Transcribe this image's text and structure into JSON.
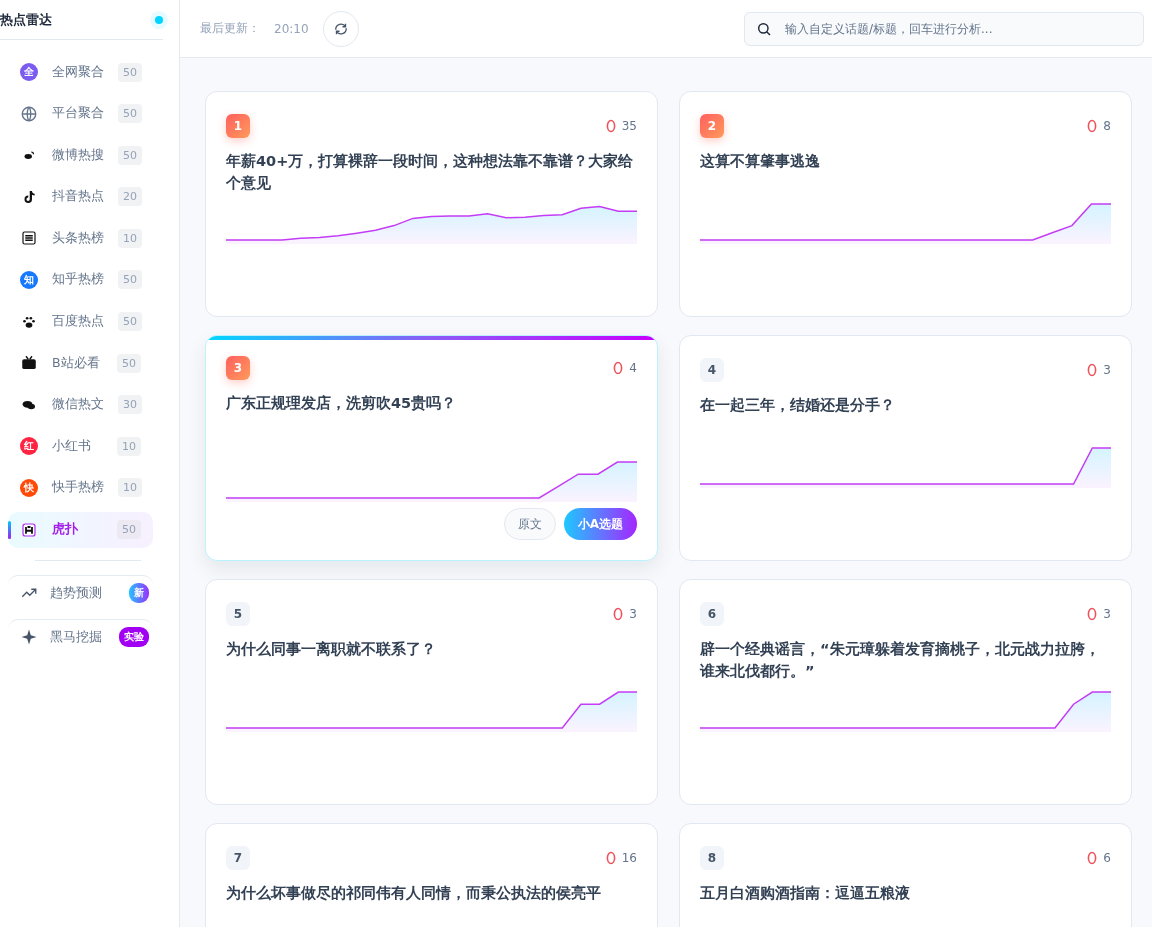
{
  "sidebar": {
    "title": "热点雷达",
    "status_on": true,
    "items": [
      {
        "kind": "letter",
        "icon_text": "全",
        "color": "#7b5cf0",
        "label": "全网聚合",
        "count": "50",
        "selected": false
      },
      {
        "kind": "globe",
        "label": "平台聚合",
        "count": "50",
        "selected": false
      },
      {
        "kind": "weibo",
        "label": "微博热搜",
        "count": "50",
        "selected": false
      },
      {
        "kind": "douyin",
        "label": "抖音热点",
        "count": "20",
        "selected": false
      },
      {
        "kind": "toutiao",
        "label": "头条热榜",
        "count": "10",
        "selected": false
      },
      {
        "kind": "letter",
        "icon_text": "知",
        "color": "#1677ff",
        "label": "知乎热榜",
        "count": "50",
        "selected": false
      },
      {
        "kind": "paw",
        "label": "百度热点",
        "count": "50",
        "selected": false
      },
      {
        "kind": "tv",
        "label": "B站必看",
        "count": "50",
        "selected": false
      },
      {
        "kind": "wechat",
        "label": "微信热文",
        "count": "30",
        "selected": false
      },
      {
        "kind": "letter",
        "icon_text": "红",
        "color": "#ff2442",
        "label": "小红书",
        "count": "10",
        "selected": false
      },
      {
        "kind": "letter",
        "icon_text": "快",
        "color": "#ff4906",
        "label": "快手热榜",
        "count": "10",
        "selected": false
      },
      {
        "kind": "hupu",
        "label": "虎扑",
        "count": "50",
        "selected": true
      }
    ],
    "tools": [
      {
        "kind": "trend",
        "label": "趋势预测",
        "badge": "新"
      },
      {
        "kind": "sparkle",
        "label": "黑马挖掘",
        "badge": "实验"
      }
    ]
  },
  "topbar": {
    "updated_label": "最后更新：",
    "updated_time": "20:10",
    "search": {
      "placeholder": "输入自定义话题/标题，回车进行分析..."
    }
  },
  "cards": [
    {
      "rank": "1",
      "top": true,
      "heat": "35",
      "title": "年薪40+万，打算裸辞一段时间，这种想法靠不靠谱？大家给个意见",
      "selected": false
    },
    {
      "rank": "2",
      "top": true,
      "heat": "8",
      "title": "这算不算肇事逃逸",
      "selected": false
    },
    {
      "rank": "3",
      "top": true,
      "heat": "4",
      "title": "广东正规理发店，洗剪吹45贵吗？",
      "selected": true,
      "actions": [
        "原文",
        "小A选题"
      ]
    },
    {
      "rank": "4",
      "top": false,
      "heat": "3",
      "title": "在一起三年，结婚还是分手？",
      "selected": false
    },
    {
      "rank": "5",
      "top": false,
      "heat": "3",
      "title": "为什么同事一离职就不联系了？",
      "selected": false
    },
    {
      "rank": "6",
      "top": false,
      "heat": "3",
      "title": "辟一个经典谣言，“朱元璋躲着发育摘桃子，北元战力拉胯，谁来北伐都行。”",
      "selected": false
    },
    {
      "rank": "7",
      "top": false,
      "heat": "16",
      "title": "为什么坏事做尽的祁同伟有人同情，而秉公执法的侯亮平",
      "selected": false
    },
    {
      "rank": "8",
      "top": false,
      "heat": "6",
      "title": "五月白酒购酒指南：逗逼五粮液",
      "selected": false
    }
  ]
}
